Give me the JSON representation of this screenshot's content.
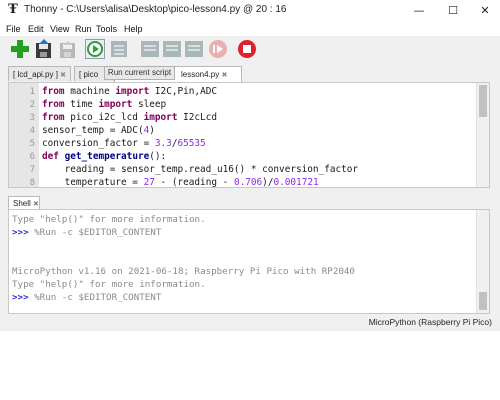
{
  "window": {
    "app_icon_glyph": "Ŧ",
    "title": "Thonny  -  C:\\Users\\alisa\\Desktop\\pico-lesson4.py  @  20 : 16",
    "controls": {
      "minimize": "—",
      "maximize": "☐",
      "close": "✕"
    }
  },
  "menu": [
    "File",
    "Edit",
    "View",
    "Run",
    "Tools",
    "Help"
  ],
  "toolbar": {
    "buttons": [
      "new-file",
      "load-file",
      "save-file",
      "run-current-script",
      "debug-current-script",
      "step-over",
      "step-into",
      "step-out",
      "resume",
      "stop"
    ],
    "colors": {
      "new": "#22a022",
      "run": "#2e9e3a",
      "stop": "#e02030",
      "disabled": "#a8b8b8"
    }
  },
  "tooltip": "Run current script",
  "editor_tabs": [
    {
      "label": "[ lcd_api.py ]",
      "close": "✖"
    },
    {
      "label": "[ pico",
      "close": ""
    },
    {
      "label": "lesson4.py",
      "close": "✖"
    }
  ],
  "editor": {
    "line_numbers": [
      "1",
      "2",
      "3",
      "4",
      "5",
      "6",
      "7",
      "8"
    ],
    "lines": [
      [
        {
          "t": "from",
          "c": "kw"
        },
        {
          "t": " machine ",
          "c": ""
        },
        {
          "t": "import",
          "c": "kw"
        },
        {
          "t": " I2C,Pin,ADC",
          "c": ""
        }
      ],
      [
        {
          "t": "from",
          "c": "kw"
        },
        {
          "t": " time ",
          "c": ""
        },
        {
          "t": "import",
          "c": "kw"
        },
        {
          "t": " sleep",
          "c": ""
        }
      ],
      [
        {
          "t": "from",
          "c": "kw"
        },
        {
          "t": " pico_i2c_lcd ",
          "c": ""
        },
        {
          "t": "import",
          "c": "kw"
        },
        {
          "t": " I2cLcd",
          "c": ""
        }
      ],
      [
        {
          "t": "sensor_temp = ADC(",
          "c": ""
        },
        {
          "t": "4",
          "c": "num"
        },
        {
          "t": ")",
          "c": ""
        }
      ],
      [
        {
          "t": "conversion_factor = ",
          "c": ""
        },
        {
          "t": "3.3",
          "c": "num"
        },
        {
          "t": "/",
          "c": ""
        },
        {
          "t": "65535",
          "c": "num"
        }
      ],
      [
        {
          "t": "def",
          "c": "kw"
        },
        {
          "t": " ",
          "c": ""
        },
        {
          "t": "get_temperature",
          "c": "fn"
        },
        {
          "t": "():",
          "c": ""
        }
      ],
      [
        {
          "t": "    reading = sensor_temp.read_u16() * conversion_factor",
          "c": ""
        }
      ],
      [
        {
          "t": "    temperature = ",
          "c": ""
        },
        {
          "t": "27",
          "c": "num"
        },
        {
          "t": " - (reading - ",
          "c": ""
        },
        {
          "t": "0.706",
          "c": "num"
        },
        {
          "t": ")/",
          "c": ""
        },
        {
          "t": "0.001721",
          "c": "num"
        }
      ]
    ]
  },
  "shell_tab": {
    "label": "Shell",
    "close": "✖"
  },
  "shell": {
    "lines": [
      {
        "text": "Type \"help()\" for more information.",
        "prompt": ""
      },
      {
        "text": " %Run -c $EDITOR_CONTENT",
        "prompt": ">>>"
      },
      {
        "text": "",
        "prompt": ""
      },
      {
        "text": "",
        "prompt": ""
      },
      {
        "text": "MicroPython v1.16 on 2021-06-18; Raspberry Pi Pico with RP2040",
        "prompt": ""
      },
      {
        "text": "Type \"help()\" for more information.",
        "prompt": ""
      },
      {
        "text": " %Run -c $EDITOR_CONTENT",
        "prompt": ">>>"
      }
    ]
  },
  "status_bar": "MicroPython (Raspberry Pi Pico)"
}
